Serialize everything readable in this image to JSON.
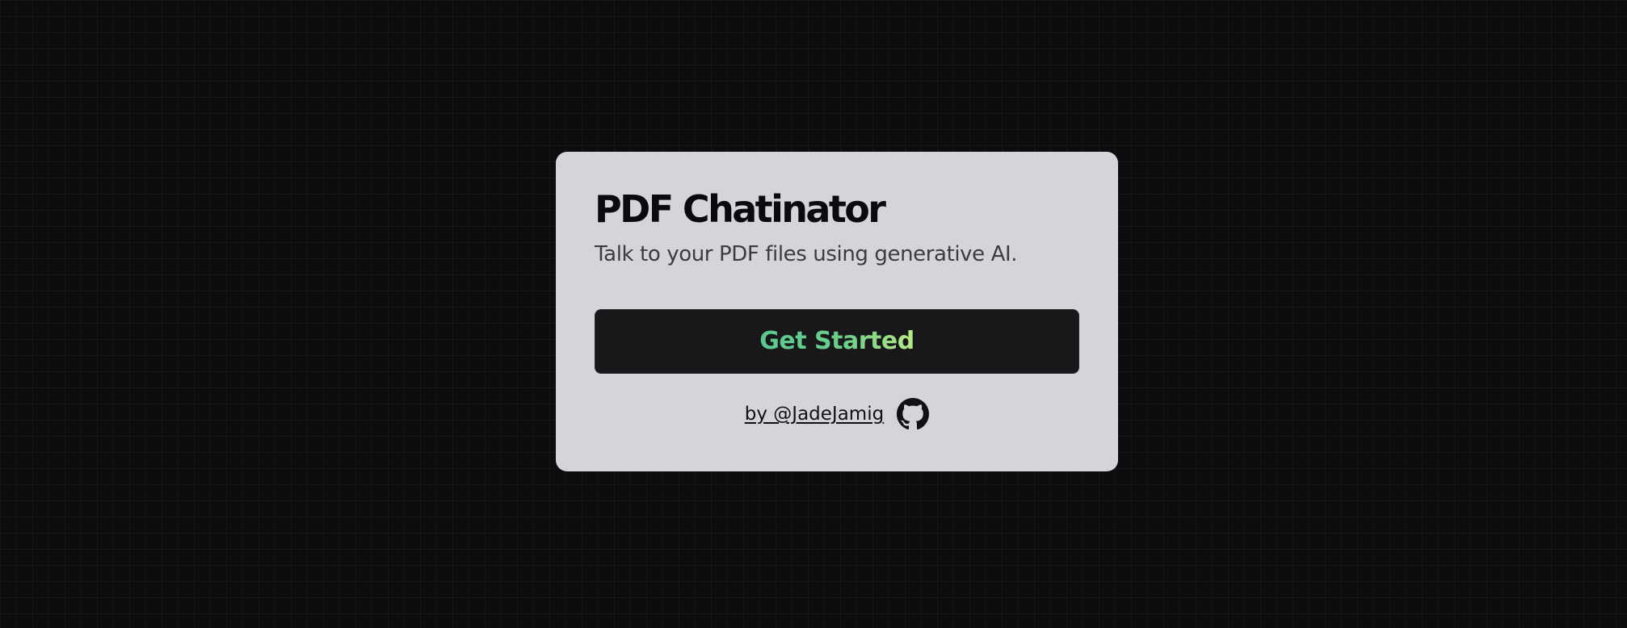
{
  "card": {
    "title": "PDF Chatinator",
    "subtitle": "Talk to your PDF files using generative AI.",
    "cta_label": "Get Started",
    "author_link": "by @JadeJamig",
    "github_icon": "github-icon"
  },
  "colors": {
    "background": "#0c0c0e",
    "card": "#d5d4d9",
    "button": "#18181b",
    "cta_gradient_start": "#5ac98f",
    "cta_gradient_end": "#b8e986"
  }
}
